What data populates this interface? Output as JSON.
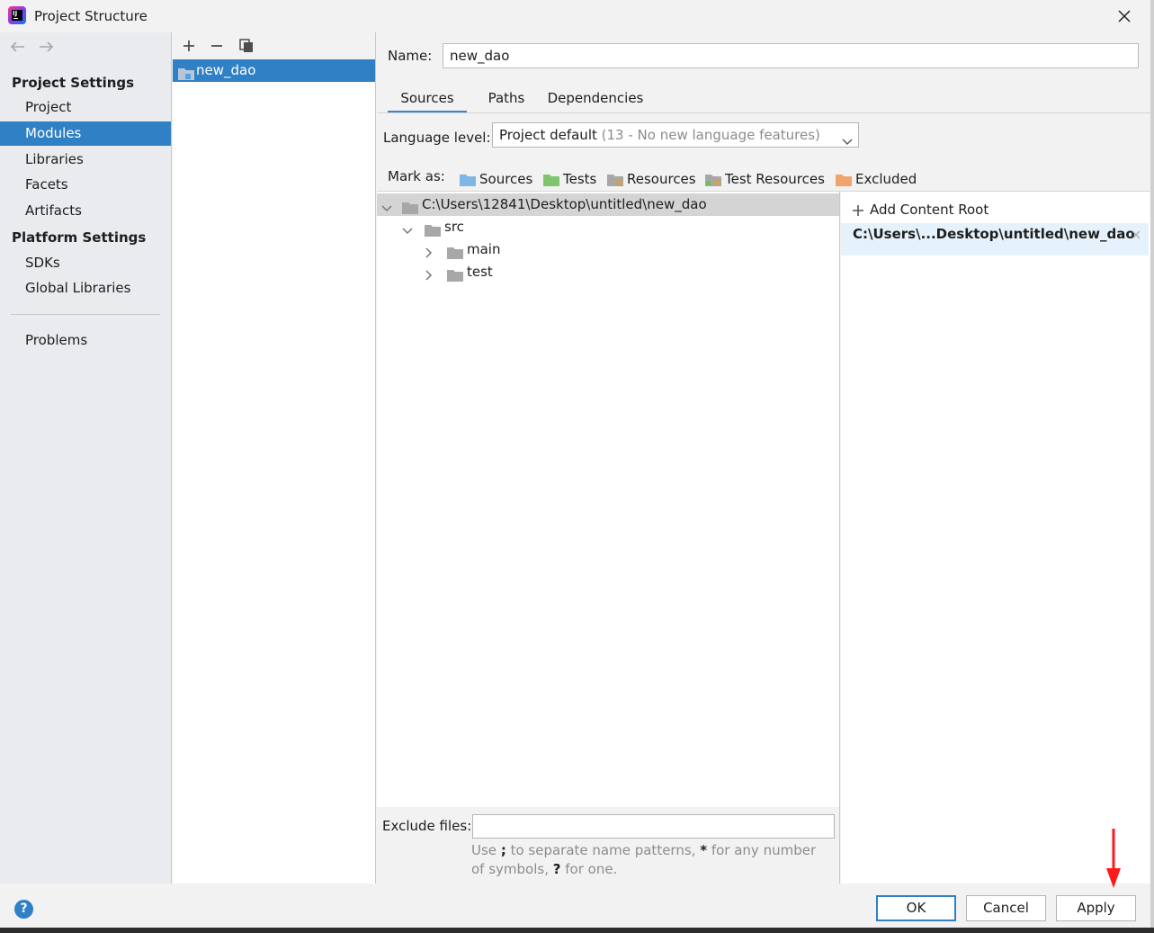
{
  "window": {
    "title": "Project Structure",
    "logo_icon": "intellij-logo-icon",
    "close_icon": "close-icon"
  },
  "nav": {
    "back_icon": "arrow-left-icon",
    "forward_icon": "arrow-right-icon",
    "project_settings_heading": "Project Settings",
    "project_settings_items": [
      "Project",
      "Modules",
      "Libraries",
      "Facets",
      "Artifacts"
    ],
    "selected": "Modules",
    "platform_settings_heading": "Platform Settings",
    "platform_settings_items": [
      "SDKs",
      "Global Libraries"
    ],
    "problems": "Problems"
  },
  "modules": {
    "toolbar_icons": [
      "plus-icon",
      "minus-icon",
      "copy-icon"
    ],
    "items": [
      "new_dao"
    ]
  },
  "module": {
    "name_label": "Name:",
    "name_value": "new_dao",
    "tabs": [
      "Sources",
      "Paths",
      "Dependencies"
    ],
    "active_tab": "Sources",
    "language_level_label": "Language level:",
    "language_level_value": "Project default",
    "language_level_hint": "(13 - No new language features)",
    "mark_as_label": "Mark as:",
    "mark_as": [
      {
        "label": "Sources",
        "color": "#7eb6e6"
      },
      {
        "label": "Tests",
        "color": "#7fc56d"
      },
      {
        "label": "Resources",
        "color": "#a7a7a7"
      },
      {
        "label": "Test Resources",
        "color": "#a7a7a7"
      },
      {
        "label": "Excluded",
        "color": "#f0a46b"
      }
    ],
    "tree": [
      {
        "label": "C:\\Users\\12841\\Desktop\\untitled\\new_dao",
        "depth": 0,
        "expanded": true,
        "selected": true
      },
      {
        "label": "src",
        "depth": 1,
        "expanded": true,
        "selected": false
      },
      {
        "label": "main",
        "depth": 2,
        "expanded": false,
        "selected": false
      },
      {
        "label": "test",
        "depth": 2,
        "expanded": false,
        "selected": false
      }
    ],
    "exclude_files_label": "Exclude files:",
    "exclude_files_value": "",
    "exclude_hint_1": "Use",
    "exclude_hint_2": ";",
    "exclude_hint_3": "to separate name patterns,",
    "exclude_hint_4": "*",
    "exclude_hint_5": "for any number of symbols,",
    "exclude_hint_6": "?",
    "exclude_hint_7": "for one.",
    "add_content_root": "Add Content Root",
    "content_root": "C:\\Users\\...Desktop\\untitled\\new_dao"
  },
  "footer": {
    "help": "?",
    "ok": "OK",
    "cancel": "Cancel",
    "apply": "Apply"
  },
  "colors": {
    "accent": "#2f80c4",
    "annotation_arrow": "#ff1a1a"
  }
}
